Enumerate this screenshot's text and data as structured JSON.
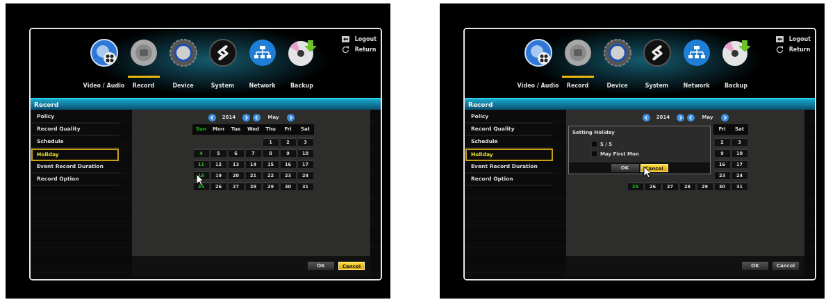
{
  "screens": [
    {
      "tabs": [
        {
          "label": "Video / Audio",
          "kind": "speaker",
          "selected": false
        },
        {
          "label": "Record",
          "kind": "lens",
          "selected": true
        },
        {
          "label": "Device",
          "kind": "knob",
          "selected": false
        },
        {
          "label": "System",
          "kind": "swirl",
          "selected": false
        },
        {
          "label": "Network",
          "kind": "network",
          "selected": false
        },
        {
          "label": "Backup",
          "kind": "disc",
          "selected": false
        }
      ],
      "logout": "Logout",
      "return": "Return",
      "section_title": "Record",
      "sidebar": [
        {
          "label": "Policy",
          "selected": false
        },
        {
          "label": "Record Quality",
          "selected": false
        },
        {
          "label": "Schedule",
          "selected": false
        },
        {
          "label": "Holiday",
          "selected": true
        },
        {
          "label": "Event Record Duration",
          "selected": false
        },
        {
          "label": "Record Option",
          "selected": false
        }
      ],
      "calendar": {
        "year": "2014",
        "month": "May",
        "weekdays": [
          {
            "kind": "label",
            "label": "Sun",
            "highlighted": true
          },
          {
            "kind": "label",
            "label": "Mon",
            "highlighted": false
          },
          {
            "kind": "label",
            "label": "Tue",
            "highlighted": false
          },
          {
            "kind": "label",
            "label": "Wed",
            "highlighted": false
          },
          {
            "kind": "label",
            "label": "Thu",
            "highlighted": false
          },
          {
            "kind": "label",
            "label": "Fri",
            "highlighted": false
          },
          {
            "kind": "label",
            "label": "Sat",
            "highlighted": false
          }
        ],
        "weeks": [
          [
            {
              "kind": "blank"
            },
            {
              "kind": "blank"
            },
            {
              "kind": "blank"
            },
            {
              "kind": "blank"
            },
            {
              "kind": "day",
              "label": "1",
              "highlighted": false,
              "pointer": false
            },
            {
              "kind": "day",
              "label": "2",
              "highlighted": false,
              "pointer": false
            },
            {
              "kind": "day",
              "label": "3",
              "highlighted": false,
              "pointer": false
            }
          ],
          [
            {
              "kind": "day",
              "label": "4",
              "highlighted": true,
              "pointer": false
            },
            {
              "kind": "day",
              "label": "5",
              "highlighted": false,
              "pointer": false
            },
            {
              "kind": "day",
              "label": "6",
              "highlighted": false,
              "pointer": false
            },
            {
              "kind": "day",
              "label": "7",
              "highlighted": false,
              "pointer": false
            },
            {
              "kind": "day",
              "label": "8",
              "highlighted": false,
              "pointer": false
            },
            {
              "kind": "day",
              "label": "9",
              "highlighted": false,
              "pointer": false
            },
            {
              "kind": "day",
              "label": "10",
              "highlighted": false,
              "pointer": false
            }
          ],
          [
            {
              "kind": "day",
              "label": "11",
              "highlighted": true,
              "pointer": false
            },
            {
              "kind": "day",
              "label": "12",
              "highlighted": false,
              "pointer": false
            },
            {
              "kind": "day",
              "label": "13",
              "highlighted": false,
              "pointer": false
            },
            {
              "kind": "day",
              "label": "14",
              "highlighted": false,
              "pointer": false
            },
            {
              "kind": "day",
              "label": "15",
              "highlighted": false,
              "pointer": false
            },
            {
              "kind": "day",
              "label": "16",
              "highlighted": false,
              "pointer": false
            },
            {
              "kind": "day",
              "label": "17",
              "highlighted": false,
              "pointer": false
            }
          ],
          [
            {
              "kind": "day",
              "label": "18",
              "highlighted": true,
              "pointer": true
            },
            {
              "kind": "day",
              "label": "19",
              "highlighted": false,
              "pointer": false
            },
            {
              "kind": "day",
              "label": "20",
              "highlighted": false,
              "pointer": false
            },
            {
              "kind": "day",
              "label": "21",
              "highlighted": false,
              "pointer": false
            },
            {
              "kind": "day",
              "label": "22",
              "highlighted": false,
              "pointer": false
            },
            {
              "kind": "day",
              "label": "23",
              "highlighted": false,
              "pointer": false
            },
            {
              "kind": "day",
              "label": "24",
              "highlighted": false,
              "pointer": false
            }
          ],
          [
            {
              "kind": "day",
              "label": "25",
              "highlighted": true,
              "pointer": false
            },
            {
              "kind": "day",
              "label": "26",
              "highlighted": false,
              "pointer": false
            },
            {
              "kind": "day",
              "label": "27",
              "highlighted": false,
              "pointer": false
            },
            {
              "kind": "day",
              "label": "28",
              "highlighted": false,
              "pointer": false
            },
            {
              "kind": "day",
              "label": "29",
              "highlighted": false,
              "pointer": false
            },
            {
              "kind": "day",
              "label": "30",
              "highlighted": false,
              "pointer": false
            },
            {
              "kind": "day",
              "label": "31",
              "highlighted": false,
              "pointer": false
            }
          ]
        ]
      },
      "buttons": [
        {
          "label": "OK",
          "selected": false
        },
        {
          "label": "Cancel",
          "selected": true
        }
      ]
    },
    {
      "tabs": [
        {
          "label": "Video / Audio",
          "kind": "speaker",
          "selected": false
        },
        {
          "label": "Record",
          "kind": "lens",
          "selected": true
        },
        {
          "label": "Device",
          "kind": "knob",
          "selected": false
        },
        {
          "label": "System",
          "kind": "swirl",
          "selected": false
        },
        {
          "label": "Network",
          "kind": "network",
          "selected": false
        },
        {
          "label": "Backup",
          "kind": "disc",
          "selected": false
        }
      ],
      "logout": "Logout",
      "return": "Return",
      "section_title": "Record",
      "sidebar": [
        {
          "label": "Policy",
          "selected": false
        },
        {
          "label": "Record Quality",
          "selected": false
        },
        {
          "label": "Schedule",
          "selected": false
        },
        {
          "label": "Holiday",
          "selected": true
        },
        {
          "label": "Event Record Duration",
          "selected": false
        },
        {
          "label": "Record Option",
          "selected": false
        }
      ],
      "calendar": {
        "year": "2014",
        "month": "May",
        "weekdays": [
          {
            "kind": "blank"
          },
          {
            "kind": "blank"
          },
          {
            "kind": "blank"
          },
          {
            "kind": "blank"
          },
          {
            "kind": "blank"
          },
          {
            "kind": "label",
            "label": "Fri",
            "highlighted": false
          },
          {
            "kind": "label",
            "label": "Sat",
            "highlighted": false
          }
        ],
        "weeks": [
          [
            {
              "kind": "blank"
            },
            {
              "kind": "blank"
            },
            {
              "kind": "blank"
            },
            {
              "kind": "blank"
            },
            {
              "kind": "blank"
            },
            {
              "kind": "day",
              "label": "2",
              "highlighted": false,
              "pointer": false
            },
            {
              "kind": "day",
              "label": "3",
              "highlighted": false,
              "pointer": false
            }
          ],
          [
            {
              "kind": "blank"
            },
            {
              "kind": "blank"
            },
            {
              "kind": "blank"
            },
            {
              "kind": "blank"
            },
            {
              "kind": "blank"
            },
            {
              "kind": "day",
              "label": "9",
              "highlighted": false,
              "pointer": false
            },
            {
              "kind": "day",
              "label": "10",
              "highlighted": false,
              "pointer": false
            }
          ],
          [
            {
              "kind": "blank"
            },
            {
              "kind": "blank"
            },
            {
              "kind": "blank"
            },
            {
              "kind": "blank"
            },
            {
              "kind": "blank"
            },
            {
              "kind": "day",
              "label": "16",
              "highlighted": false,
              "pointer": false
            },
            {
              "kind": "day",
              "label": "17",
              "highlighted": false,
              "pointer": false
            }
          ],
          [
            {
              "kind": "blank"
            },
            {
              "kind": "blank"
            },
            {
              "kind": "blank"
            },
            {
              "kind": "blank"
            },
            {
              "kind": "blank"
            },
            {
              "kind": "day",
              "label": "23",
              "highlighted": false,
              "pointer": false
            },
            {
              "kind": "day",
              "label": "24",
              "highlighted": false,
              "pointer": false
            }
          ],
          [
            {
              "kind": "day",
              "label": "25",
              "highlighted": true,
              "pointer": false
            },
            {
              "kind": "day",
              "label": "26",
              "highlighted": false,
              "pointer": false
            },
            {
              "kind": "day",
              "label": "27",
              "highlighted": false,
              "pointer": false
            },
            {
              "kind": "day",
              "label": "28",
              "highlighted": false,
              "pointer": false
            },
            {
              "kind": "day",
              "label": "29",
              "highlighted": false,
              "pointer": false
            },
            {
              "kind": "day",
              "label": "30",
              "highlighted": false,
              "pointer": false
            },
            {
              "kind": "day",
              "label": "31",
              "highlighted": false,
              "pointer": false
            }
          ]
        ]
      },
      "dialog": {
        "title": "Setting Holiday",
        "options": [
          {
            "label": "5 / 5",
            "checked": false
          },
          {
            "label": "May First Mon",
            "checked": false
          }
        ],
        "buttons": [
          {
            "label": "OK",
            "selected": false,
            "pointer": false
          },
          {
            "label": "Cancel",
            "selected": true,
            "pointer": true
          }
        ]
      },
      "buttons": [
        {
          "label": "OK",
          "selected": false
        },
        {
          "label": "Cancel",
          "selected": false
        }
      ]
    }
  ]
}
